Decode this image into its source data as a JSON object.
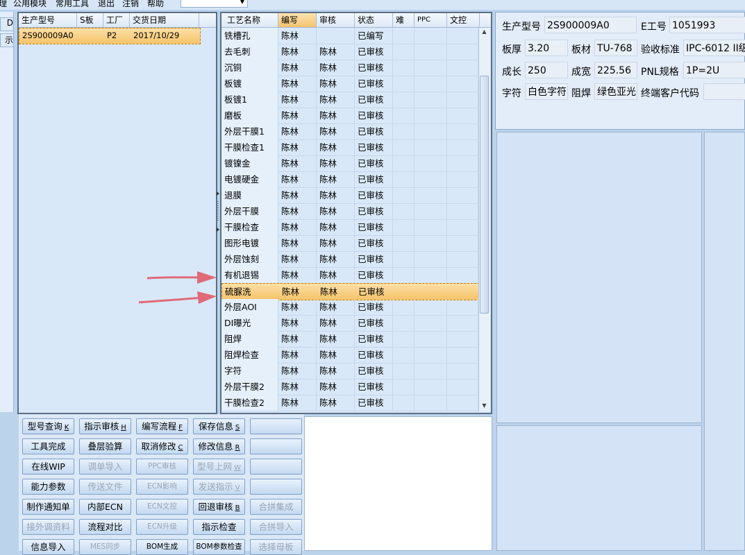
{
  "menubar": {
    "items": [
      "理",
      "公用模块",
      "常用工具",
      "退出",
      "注销",
      "帮助"
    ]
  },
  "left_stub": {
    "buttons": [
      "D",
      "示"
    ]
  },
  "model_grid": {
    "headers": [
      "生产型号",
      "S板",
      "工厂",
      "交货日期"
    ],
    "rows": [
      {
        "model": "2S900009A0",
        "s": "",
        "factory": "P2",
        "date": "2017/10/29"
      }
    ]
  },
  "process_grid": {
    "headers": [
      "工艺名称",
      "编写",
      "审核",
      "状态",
      "难",
      "PPC",
      "文控"
    ],
    "rows": [
      {
        "name": "铣槽孔",
        "writer": "陈林",
        "reviewer": "",
        "status": "已编写"
      },
      {
        "name": "去毛刺",
        "writer": "陈林",
        "reviewer": "陈林",
        "status": "已审核"
      },
      {
        "name": "沉铜",
        "writer": "陈林",
        "reviewer": "陈林",
        "status": "已审核"
      },
      {
        "name": "板镀",
        "writer": "陈林",
        "reviewer": "陈林",
        "status": "已审核"
      },
      {
        "name": "板镀1",
        "writer": "陈林",
        "reviewer": "陈林",
        "status": "已审核"
      },
      {
        "name": "磨板",
        "writer": "陈林",
        "reviewer": "陈林",
        "status": "已审核"
      },
      {
        "name": "外层干膜1",
        "writer": "陈林",
        "reviewer": "陈林",
        "status": "已审核"
      },
      {
        "name": "干膜检查1",
        "writer": "陈林",
        "reviewer": "陈林",
        "status": "已审核"
      },
      {
        "name": "镀镍金",
        "writer": "陈林",
        "reviewer": "陈林",
        "status": "已审核"
      },
      {
        "name": "电镀硬金",
        "writer": "陈林",
        "reviewer": "陈林",
        "status": "已审核"
      },
      {
        "name": "退膜",
        "writer": "陈林",
        "reviewer": "陈林",
        "status": "已审核"
      },
      {
        "name": "外层干膜",
        "writer": "陈林",
        "reviewer": "陈林",
        "status": "已审核"
      },
      {
        "name": "干膜检查",
        "writer": "陈林",
        "reviewer": "陈林",
        "status": "已审核"
      },
      {
        "name": "图形电镀",
        "writer": "陈林",
        "reviewer": "陈林",
        "status": "已审核"
      },
      {
        "name": "外层蚀刻",
        "writer": "陈林",
        "reviewer": "陈林",
        "status": "已审核"
      },
      {
        "name": "有机退锡",
        "writer": "陈林",
        "reviewer": "陈林",
        "status": "已审核"
      },
      {
        "name": "硫脲洗",
        "writer": "陈林",
        "reviewer": "陈林",
        "status": "已审核"
      },
      {
        "name": "外层AOI",
        "writer": "陈林",
        "reviewer": "陈林",
        "status": "已审核"
      },
      {
        "name": "DI曝光",
        "writer": "陈林",
        "reviewer": "陈林",
        "status": "已审核"
      },
      {
        "name": "阻焊",
        "writer": "陈林",
        "reviewer": "陈林",
        "status": "已审核"
      },
      {
        "name": "阻焊检查",
        "writer": "陈林",
        "reviewer": "陈林",
        "status": "已审核"
      },
      {
        "name": "字符",
        "writer": "陈林",
        "reviewer": "陈林",
        "status": "已审核"
      },
      {
        "name": "外层干膜2",
        "writer": "陈林",
        "reviewer": "陈林",
        "status": "已审核"
      },
      {
        "name": "干膜检查2",
        "writer": "陈林",
        "reviewer": "陈林",
        "status": "已审核"
      }
    ],
    "selected_row": 16
  },
  "info": {
    "model_label": "生产型号",
    "model_value": "2S900009A0",
    "eno_label": "E工号",
    "eno_value": "1051993",
    "thickness_label": "板厚",
    "thickness_value": "3.20",
    "material_label": "板材",
    "material_value": "TU-768",
    "standard_label": "验收标准",
    "standard_value": "IPC-6012 II级",
    "length_label": "成长",
    "length_value": "250",
    "width_label": "成宽",
    "width_value": "225.56",
    "pnl_label": "PNL规格",
    "pnl_value": "1P=2U",
    "char_label": "字符",
    "char_value": "白色字符",
    "mask_label": "阻焊",
    "mask_value": "绿色亚光",
    "customer_label": "终端客户代码",
    "customer_value": ""
  },
  "buttons": [
    [
      "型号查询",
      "K",
      "指示审核",
      "H",
      "编写流程",
      "F",
      "保存信息",
      "S",
      "",
      ""
    ],
    [
      "工具完成",
      "",
      "叠层验算",
      "",
      "取消修改",
      "C",
      "修改信息",
      "R",
      "",
      ""
    ],
    [
      "在线WIP",
      "",
      "调单导入",
      "",
      "PPC审核",
      "",
      "型号上网",
      "W",
      "",
      ""
    ],
    [
      "能力参数",
      "",
      "传送文件",
      "",
      "ECN影响",
      "",
      "发送指示",
      "V",
      "",
      ""
    ],
    [
      "制作通知单",
      "",
      "内部ECN",
      "",
      "ECN文控",
      "",
      "回退审核",
      "B",
      "合拼集成",
      ""
    ],
    [
      "接外调资料",
      "",
      "流程对比",
      "",
      "ECN升级",
      "",
      "指示检查",
      "",
      "合拼导入",
      ""
    ],
    [
      "信息导入",
      "",
      "MES同步",
      "",
      "BOM生成",
      "",
      "BOM参数检查",
      "",
      "选择母板",
      ""
    ]
  ],
  "colors": {
    "selection": "#f5c36a",
    "arrow": "#e06a78",
    "panel_bg": "#d9e8f8"
  }
}
